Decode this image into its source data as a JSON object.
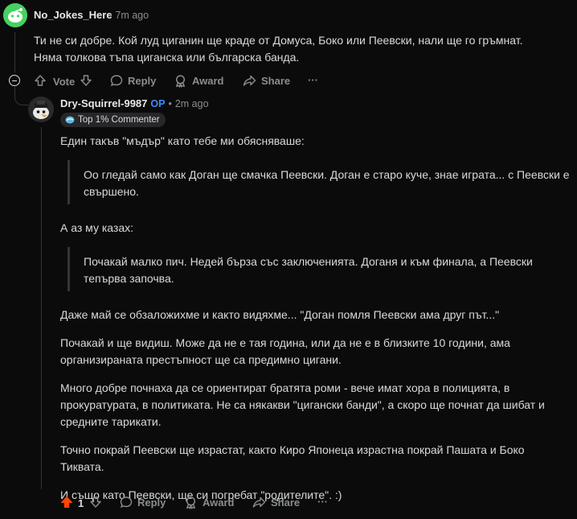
{
  "comment1": {
    "username": "No_Jokes_Here",
    "time": "7m ago",
    "text": "Ти не си добре. Кой луд циганин ще краде от Домуса, Боко или Пеевски, нали ще го гръмнат. Няма толкова тъпа циганска или българска банда.",
    "actions": {
      "vote": "Vote",
      "reply": "Reply",
      "award": "Award",
      "share": "Share",
      "more": "···"
    }
  },
  "comment2": {
    "username": "Dry-Squirrel-9987",
    "op_label": "OP",
    "time": "2m ago",
    "badge": "Top 1% Commenter",
    "paragraphs": [
      "Един такъв \"мъдър\" като тебе ми обясняваше:",
      "Оо гледай само как Доган ще смачка Пеевски. Доган е старо куче, знае играта... с Пеевски е свършено.",
      "А аз му казах:",
      "Почакай малко пич. Недей бърза със заключенията. Доганя и към финала, а Пеевски тепърва започва.",
      "Даже май се обзаложихме и както видяхме... \"Доган помля Пеевски ама друг път...\"",
      "Почакай и ще видиш. Може да не е тая година, или да не е в близките 10 години, ама организираната престъпност ще са предимно цигани.",
      "Много добре почнаха да се ориентират братята роми - вече имат хора в полицията, в прокуратурата, в политиката. Не са някакви \"цигански банди\", а скоро ще почнат да шибат и средните тарикати.",
      "Точно покрай Пеевски ще израстат, както Киро Японеца израстна покрай Пашата и Боко Тиквата.",
      "И също като Пеевски, ще си погребат \"родителите\". :)"
    ],
    "actions": {
      "score": "1",
      "reply": "Reply",
      "award": "Award",
      "share": "Share",
      "more": "···"
    }
  },
  "colors": {
    "upvote_active": "#ff4500",
    "op": "#3d8bfd",
    "avatar1_bg": "#46d160"
  }
}
